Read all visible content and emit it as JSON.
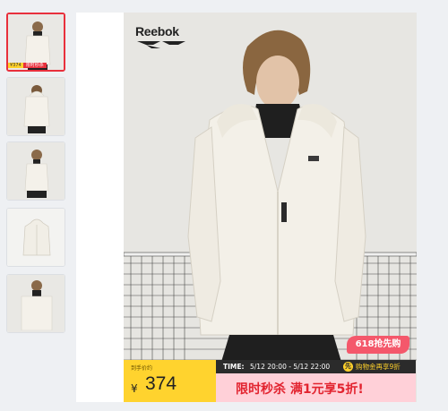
{
  "thumbnails": [
    {
      "alt": "front view",
      "active": true,
      "price_tag": "¥374",
      "promo_tag": "限时秒杀"
    },
    {
      "alt": "back view",
      "active": false
    },
    {
      "alt": "side view",
      "active": false
    },
    {
      "alt": "flat jacket",
      "active": false
    },
    {
      "alt": "detail close-up",
      "active": false
    }
  ],
  "main_image": {
    "brand_logo": "Reebok",
    "badge": "618抢先购"
  },
  "promo": {
    "price_label": "到手价约",
    "currency": "¥",
    "price": "374",
    "time_label": "TIME:",
    "time_value": "5/12 20:00 - 5/12 22:00",
    "presale_icon": "先",
    "presale_text": "购物金再享9折",
    "sale_text": "限时秒杀  满1元享5折!"
  },
  "colors": {
    "accent_red": "#e8303c",
    "price_yellow": "#ffd32e",
    "sale_pink": "#ffd0d8",
    "badge_pink": "#f4586b"
  }
}
